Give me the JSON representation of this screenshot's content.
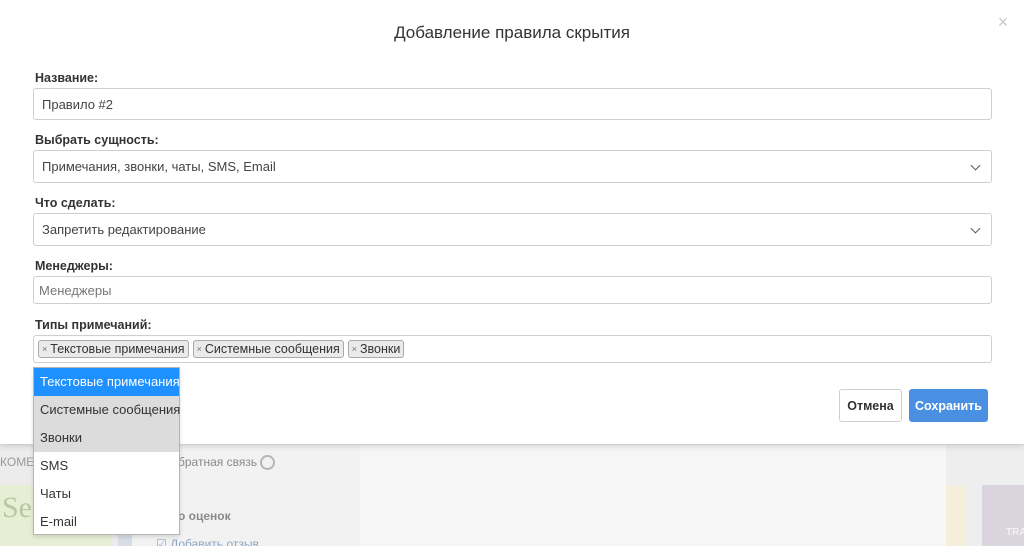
{
  "modal": {
    "title": "Добавление правила скрытия",
    "close_symbol": "×"
  },
  "form": {
    "name": {
      "label": "Название:",
      "value": "Правило #2"
    },
    "entity": {
      "label": "Выбрать сущность:",
      "value": "Примечания, звонки, чаты, SMS, Email"
    },
    "action": {
      "label": "Что сделать:",
      "value": "Запретить редактирование"
    },
    "managers": {
      "label": "Менеджеры:",
      "placeholder": "Менеджеры"
    },
    "note_types": {
      "label": "Типы примечаний:",
      "tags": [
        "Текстовые примечания",
        "Системные сообщения",
        "Звонки"
      ],
      "tag_remove_symbol": "×"
    }
  },
  "dropdown": {
    "options": [
      "Текстовые примечания",
      "Системные сообщения",
      "Звонки",
      "SMS",
      "Чаты",
      "E-mail"
    ],
    "highlighted_option": "Текстовые примечания"
  },
  "buttons": {
    "cancel": "Отмена",
    "save": "Сохранить"
  },
  "background": {
    "tab_text": "КОМЕ",
    "feedback_text": "братная связь",
    "ratings_text": "о оценок",
    "add_review_text": "☑ Добавить отзыв",
    "card_letter": "Se",
    "purple_card_text": "TRA"
  },
  "colors": {
    "accent": "#4a90e2",
    "option_highlight": "#1e90ff",
    "selected_option_bg": "#dcdcdc"
  }
}
